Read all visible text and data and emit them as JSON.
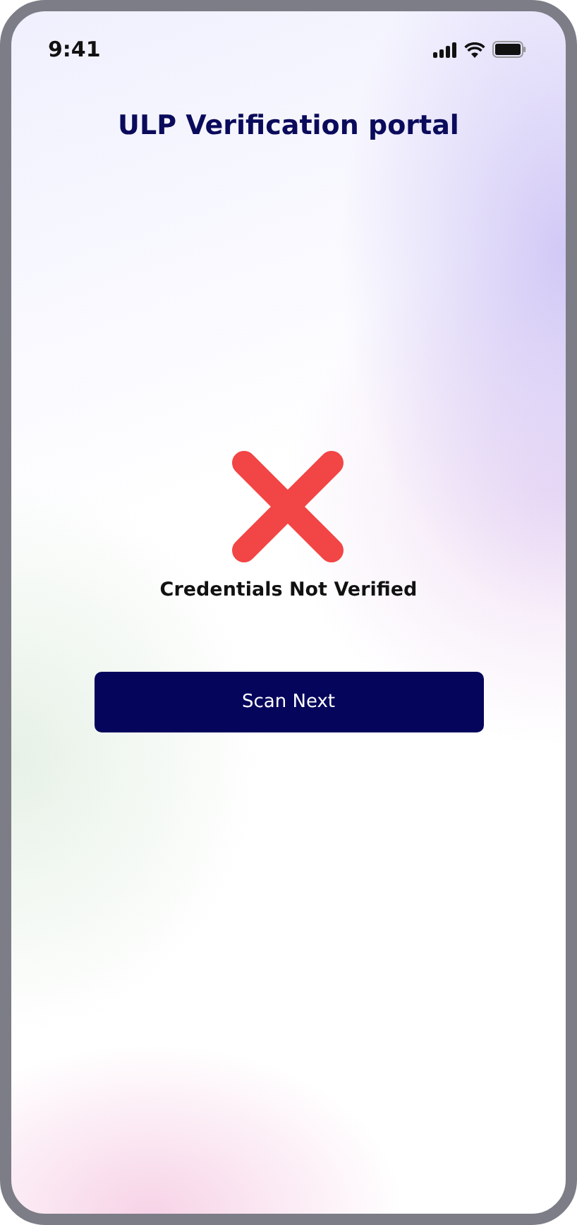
{
  "status_bar": {
    "time": "9:41"
  },
  "title": "ULP Verification portal",
  "result": {
    "kind": "failure",
    "message": "Credentials Not Verified"
  },
  "buttons": [
    {
      "label": "Scan Next"
    }
  ]
}
